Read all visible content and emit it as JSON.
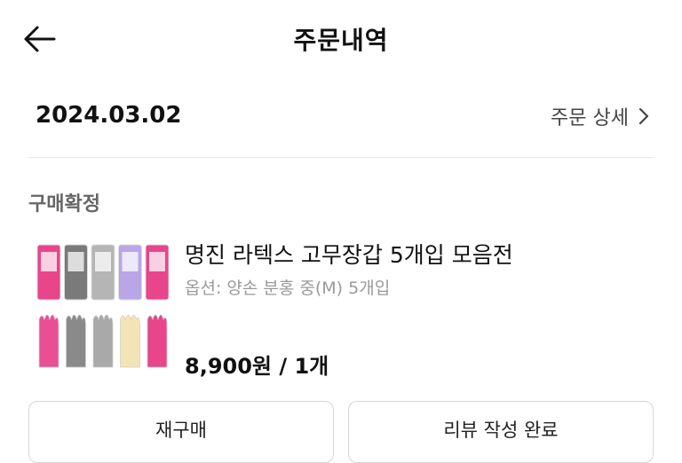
{
  "header": {
    "title": "주문내역",
    "back_icon": "arrow-left-icon"
  },
  "order": {
    "date": "2024.03.02",
    "detail_link_label": "주문 상세",
    "detail_icon": "chevron-right-icon",
    "status": "구매확정"
  },
  "product": {
    "name": "명진 라텍스 고무장갑 5개입 모음전",
    "option": "옵션: 양손 분홍 중(M) 5개입",
    "price": "8,900원 / 1개",
    "thumbnail_colors": [
      "#e8458a",
      "#7a7a7a",
      "#b5b5b5",
      "#b9a6e6",
      "#e8458a"
    ]
  },
  "actions": {
    "rebuy_label": "재구매",
    "review_label": "리뷰 작성 완료"
  }
}
